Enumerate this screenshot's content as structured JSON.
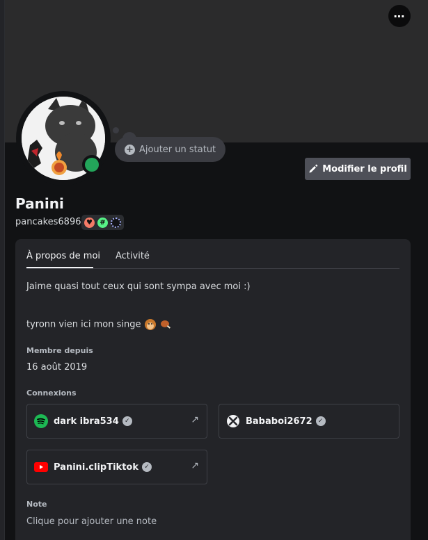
{
  "header": {
    "more_label": "⋯",
    "add_status_label": "Ajouter un statut",
    "edit_profile_label": "Modifier le profil"
  },
  "profile": {
    "display_name": "Panini",
    "username": "pancakes6896",
    "status": "online",
    "badges": [
      "hypesquad-badge",
      "hashtag-badge",
      "nitro-badge"
    ]
  },
  "tabs": [
    {
      "label": "À propos de moi",
      "active": true
    },
    {
      "label": "Activité",
      "active": false
    }
  ],
  "about": {
    "line1": "Jaime quasi tout ceux qui sont sympa avec moi  :)",
    "line2": "tyronn vien ici mon singe"
  },
  "member_since": {
    "title": "Membre depuis",
    "value": "16 août 2019"
  },
  "connections": {
    "title": "Connexions",
    "items": [
      {
        "service": "spotify",
        "icon": "spotify-icon",
        "name": "dark ibra534"
      },
      {
        "service": "xbox",
        "icon": "xbox-icon",
        "name": "Bababoi2672"
      },
      {
        "service": "youtube",
        "icon": "youtube-icon",
        "name": "Panini.clipTiktok"
      }
    ]
  },
  "note": {
    "title": "Note",
    "placeholder": "Clique pour ajouter une note"
  },
  "colors": {
    "online": "#23a55a",
    "spotify": "#1db954",
    "youtube": "#ff0000"
  }
}
